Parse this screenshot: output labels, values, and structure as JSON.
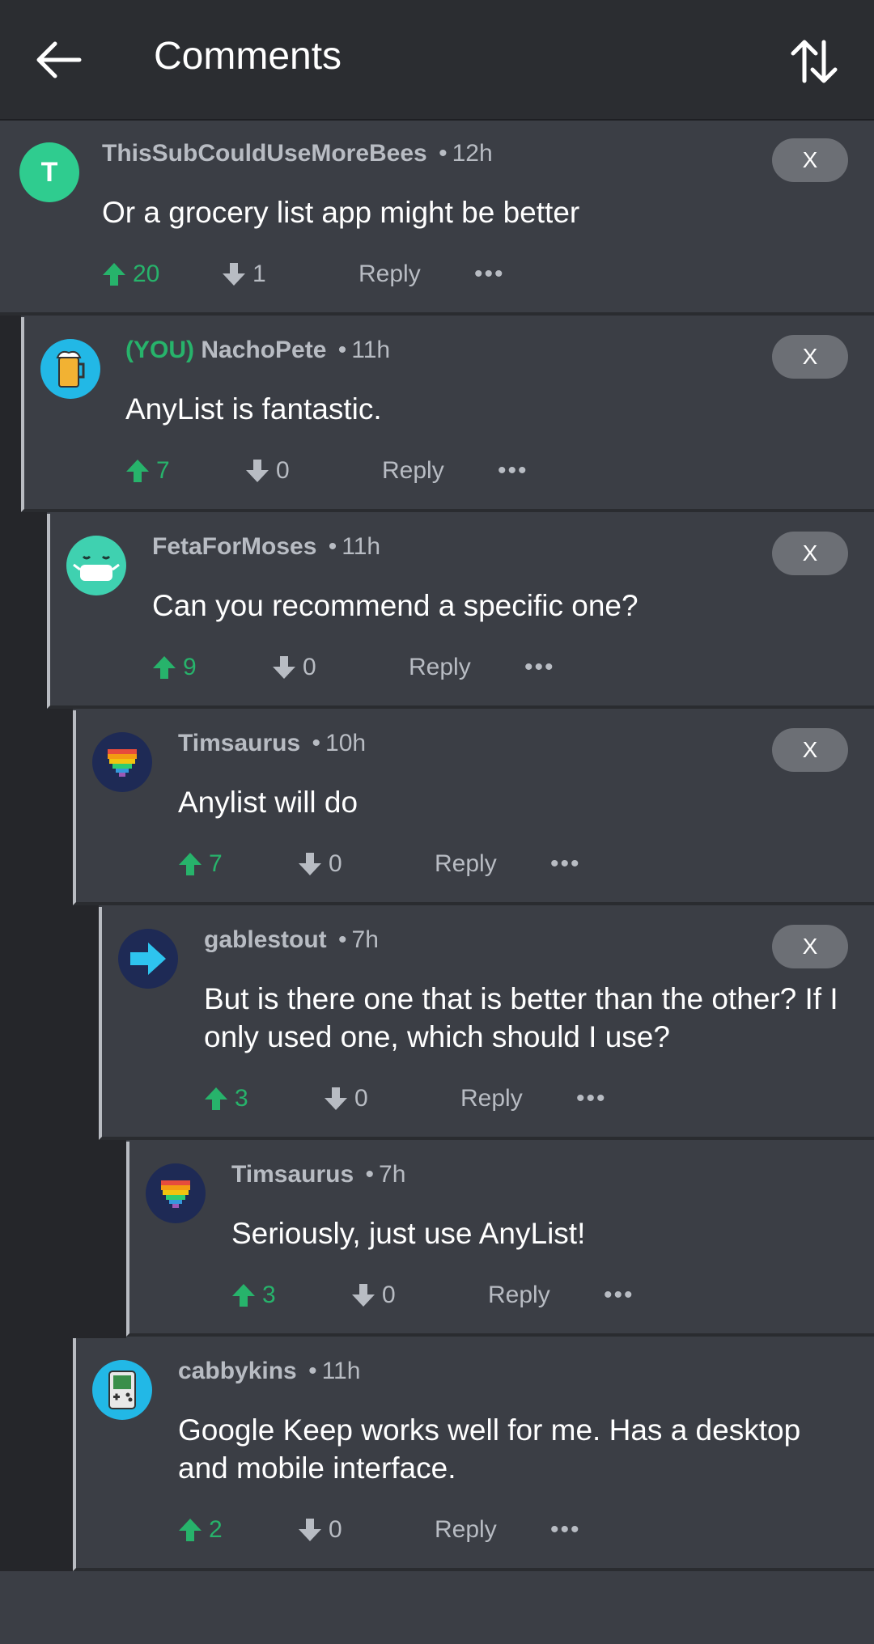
{
  "header": {
    "title": "Comments",
    "back_icon": "arrow-left-icon",
    "sort_icon": "sort-arrows-icon"
  },
  "labels": {
    "reply": "Reply",
    "close": "X",
    "more": "•••",
    "separator": "•"
  },
  "colors": {
    "upvote": "#27b36b",
    "text": "#ffffff",
    "muted": "#b8bcc3",
    "background": "#3b3e45",
    "topbar": "#2b2d31"
  },
  "comments": [
    {
      "you_tag": "",
      "user": "ThisSubCouldUseMoreBees",
      "time": "12h",
      "text": "Or a grocery list app might be better",
      "upvotes": "20",
      "downvotes": "1",
      "avatar": "letter-t-avatar",
      "avatar_letter": "T"
    },
    {
      "you_tag": "(YOU)",
      "user": "NachoPete",
      "time": "11h",
      "text": "AnyList is fantastic.",
      "upvotes": "7",
      "downvotes": "0",
      "avatar": "beer-avatar"
    },
    {
      "you_tag": "",
      "user": "FetaForMoses",
      "time": "11h",
      "text": "Can you recommend a specific one?",
      "upvotes": "9",
      "downvotes": "0",
      "avatar": "mask-face-avatar"
    },
    {
      "you_tag": "",
      "user": "Timsaurus",
      "time": "10h",
      "text": "Anylist will do",
      "upvotes": "7",
      "downvotes": "0",
      "avatar": "rainbow-heart-avatar"
    },
    {
      "you_tag": "",
      "user": "gablestout",
      "time": "7h",
      "text": "But is there one that is better than the other? If I only used one, which should I use?",
      "upvotes": "3",
      "downvotes": "0",
      "avatar": "arrow-right-avatar"
    },
    {
      "you_tag": "",
      "user": "Timsaurus",
      "time": "7h",
      "text": "Seriously, just use AnyList!",
      "upvotes": "3",
      "downvotes": "0",
      "avatar": "rainbow-heart-avatar"
    },
    {
      "you_tag": "",
      "user": "cabbykins",
      "time": "11h",
      "text": "Google Keep works well for me. Has a desktop and mobile interface.",
      "upvotes": "2",
      "downvotes": "0",
      "avatar": "gameboy-avatar"
    }
  ]
}
